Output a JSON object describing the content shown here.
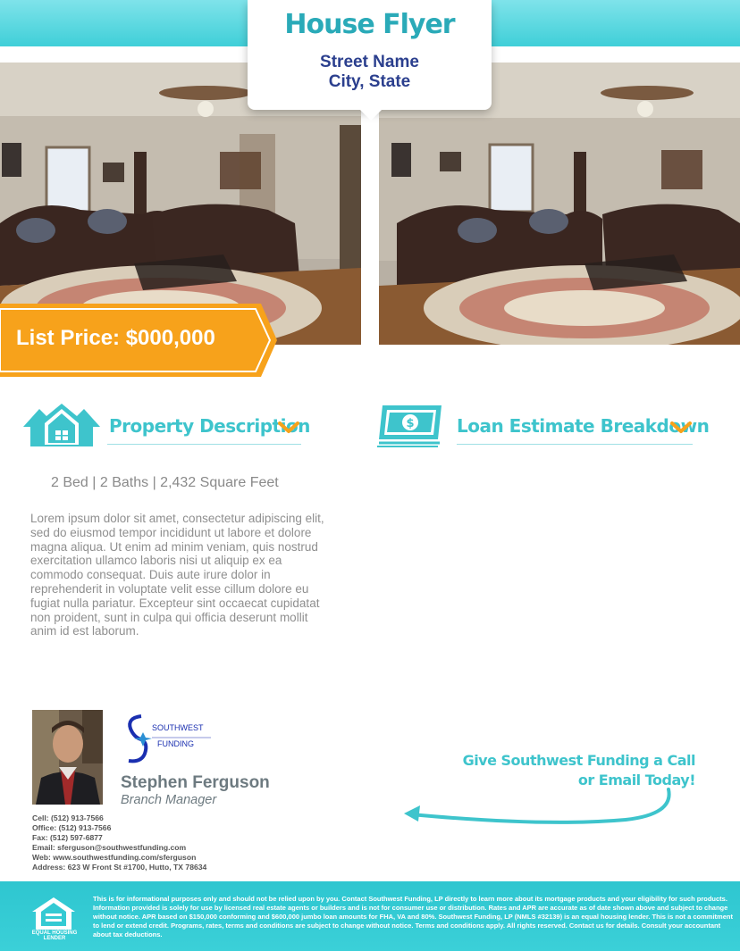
{
  "flyer": {
    "title": "House Flyer",
    "street": "Street Name",
    "city_state": "City, State",
    "price": "List Price: $000,000"
  },
  "sections": {
    "property": {
      "title": "Property Description",
      "icon": "house-icon"
    },
    "loan": {
      "title": "Loan Estimate Breakdown",
      "icon": "dollar-bill-icon"
    }
  },
  "property": {
    "specs": "2 Bed | 2 Baths | 2,432 Square Feet",
    "description": "Lorem ipsum dolor sit amet, consectetur adipiscing elit, sed do eiusmod tempor incididunt ut labore et dolore magna aliqua. Ut enim ad minim veniam, quis nostrud exercitation ullamco laboris nisi ut aliquip ex ea commodo consequat. Duis aute irure dolor in reprehenderit in voluptate velit esse cillum dolore eu fugiat nulla pariatur. Excepteur sint occaecat cupidatat non proident, sunt in culpa qui officia deserunt mollit anim id est laborum."
  },
  "agent": {
    "name": "Stephen Ferguson",
    "title": "Branch Manager",
    "logo_line1": "SOUTHWEST",
    "logo_line2": "FUNDING",
    "contact": [
      "Cell:  (512) 913-7566",
      "Office:  (512) 913-7566",
      "Fax:  (512) 597-6877",
      "Email:  sferguson@southwestfunding.com",
      "Web:  www.southwestfunding.com/sferguson",
      "Address:  623 W Front St #1700, Hutto, TX 78634"
    ]
  },
  "cta": {
    "line1": "Give Southwest Funding a Call",
    "line2": "or Email Today!"
  },
  "footer": {
    "eho_label": "EQUAL HOUSING LENDER",
    "disclaimer": "This is for informational purposes only and should not be relied upon by you. Contact Southwest Funding, LP directly to learn more about its mortgage products and your eligibility for such products. Information provided is solely for use by licensed real estate agents or builders and is not for consumer use or distribution. Rates and APR are accurate as of date shown above and subject to change without notice. APR based on $150,000 conforming and $600,000 jumbo loan amounts for FHA, VA and 80%. Southwest Funding, LP (NMLS #32139) is an equal housing lender. This is not a commitment to lend or extend credit. Programs, rates, terms and conditions are subject to change without notice. Terms and conditions apply. All rights reserved. Contact us for details. Consult your accountant about tax deductions."
  },
  "colors": {
    "accent": "#3ec4cc",
    "navy": "#2b3f8e",
    "orange": "#f7a21b"
  }
}
